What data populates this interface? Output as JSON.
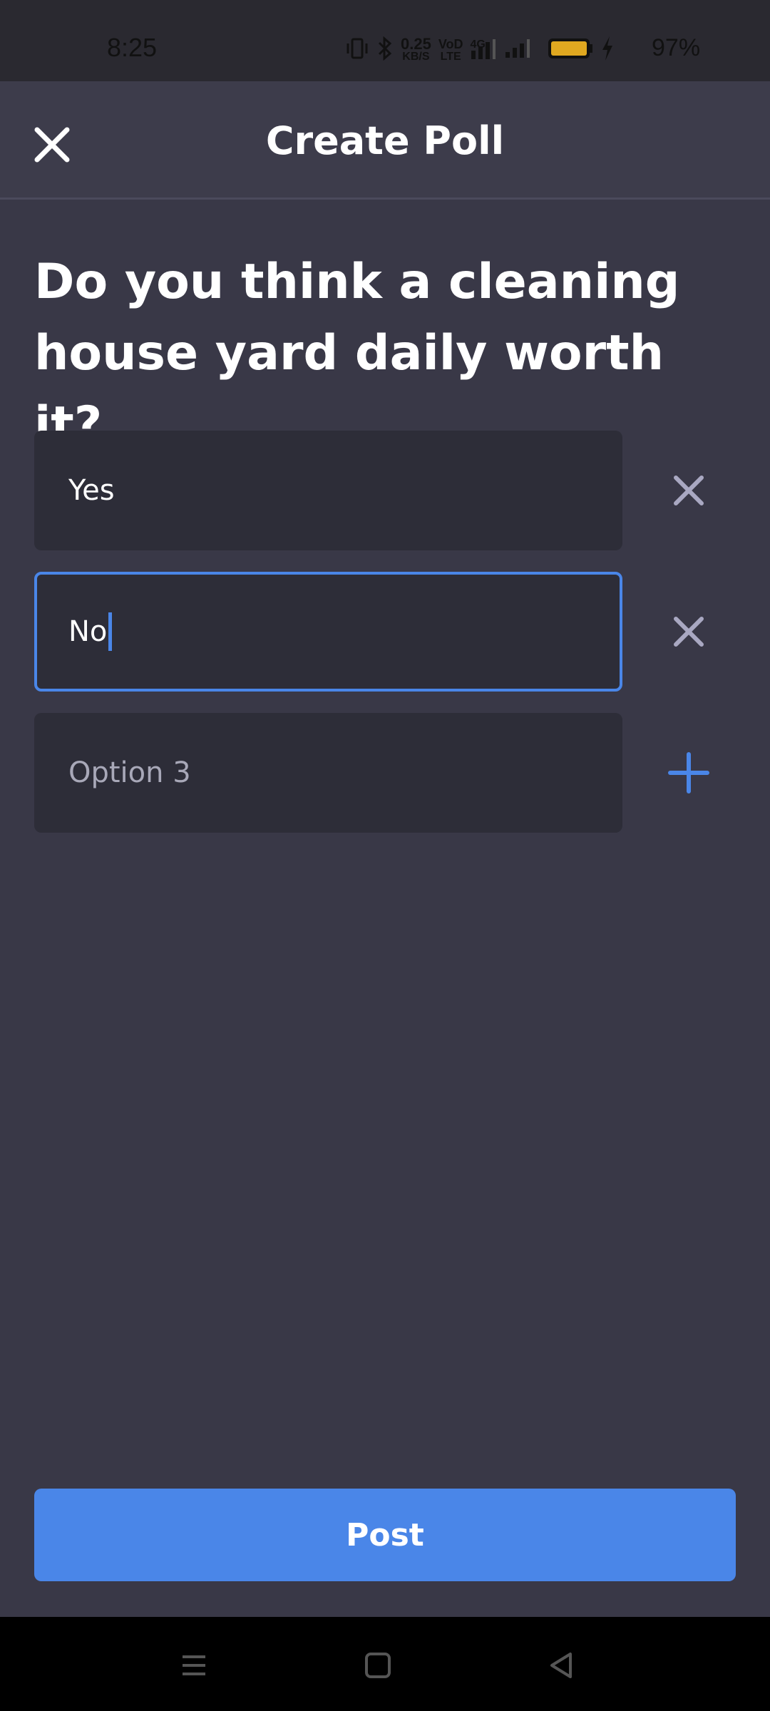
{
  "status_bar": {
    "time": "8:25",
    "net_speed_value": "0.25",
    "net_speed_unit": "KB/S",
    "volte_top": "VoD",
    "volte_bottom": "LTE",
    "network_type": "4G",
    "battery_percent": "97%",
    "battery_color": "#e0a820"
  },
  "header": {
    "title": "Create Poll",
    "close_icon": "close-icon"
  },
  "question": "Do you think a cleaning house yard daily worth it?",
  "options": [
    {
      "value": "Yes",
      "placeholder": "",
      "focused": false,
      "action": "remove"
    },
    {
      "value": "No",
      "placeholder": "",
      "focused": true,
      "action": "remove"
    },
    {
      "value": "",
      "placeholder": "Option 3",
      "focused": false,
      "action": "add"
    }
  ],
  "post_button": {
    "label": "Post"
  },
  "colors": {
    "accent": "#4a86e8",
    "background": "#393847",
    "field": "#2d2d38",
    "remove_icon": "#a9a8c2"
  },
  "nav": {
    "menu_icon": "menu-icon",
    "home_icon": "home-icon",
    "back_icon": "back-icon"
  }
}
